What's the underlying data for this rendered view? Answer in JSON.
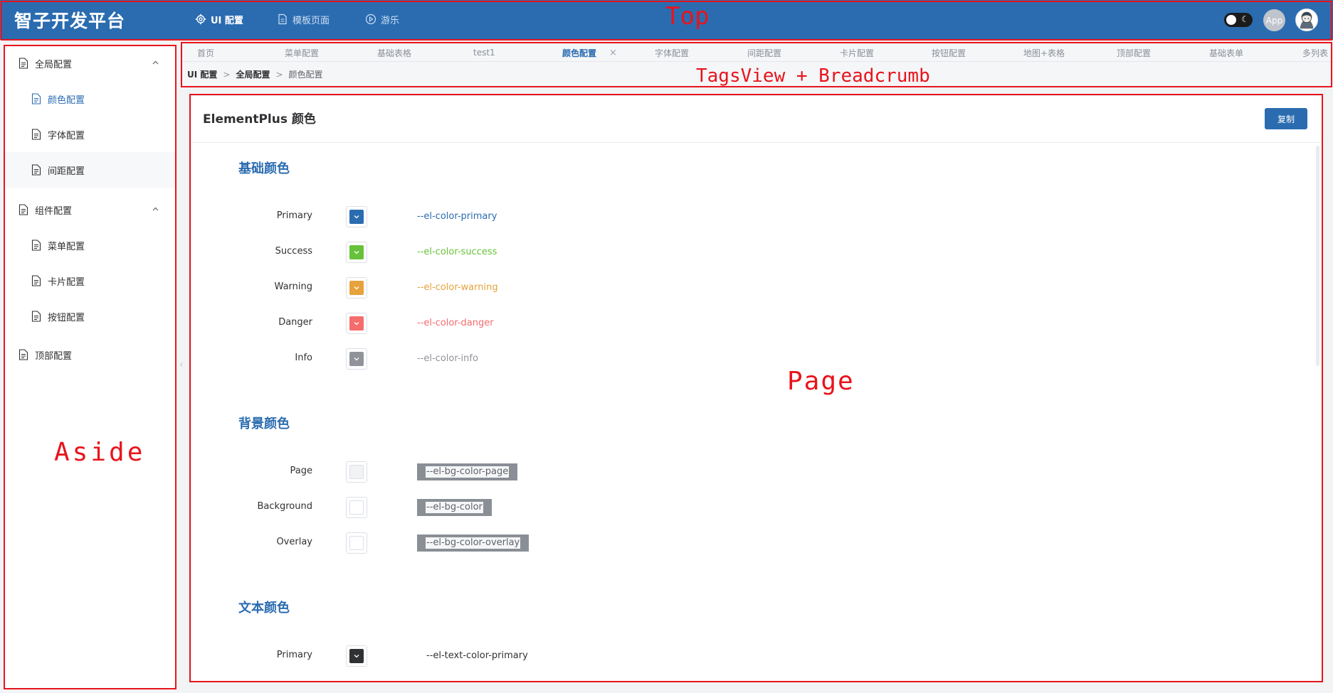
{
  "top": {
    "logo": "智子开发平台",
    "menu": [
      {
        "label": "UI 配置",
        "icon": "gear-icon",
        "active": true
      },
      {
        "label": "模板页面",
        "icon": "document-icon",
        "active": false
      },
      {
        "label": "游乐",
        "icon": "play-circle-icon",
        "active": false
      }
    ],
    "app_label": "App",
    "theme_toggle": "dark-mode-toggle"
  },
  "aside": {
    "groups": [
      {
        "label": "全局配置",
        "icon": "document-icon",
        "expanded": true,
        "items": [
          {
            "label": "颜色配置",
            "active": true
          },
          {
            "label": "字体配置",
            "active": false
          },
          {
            "label": "间距配置",
            "active": false
          }
        ]
      },
      {
        "label": "组件配置",
        "icon": "document-icon",
        "expanded": true,
        "items": [
          {
            "label": "菜单配置",
            "active": false
          },
          {
            "label": "卡片配置",
            "active": false
          },
          {
            "label": "按钮配置",
            "active": false
          }
        ]
      },
      {
        "label": "顶部配置",
        "icon": "document-icon",
        "expanded": false,
        "items": []
      }
    ]
  },
  "tags": [
    {
      "label": "首页",
      "active": false
    },
    {
      "label": "菜单配置",
      "active": false
    },
    {
      "label": "基础表格",
      "active": false
    },
    {
      "label": "test1",
      "active": false
    },
    {
      "label": "颜色配置",
      "active": true,
      "close": "×"
    },
    {
      "label": "字体配置",
      "active": false
    },
    {
      "label": "间距配置",
      "active": false
    },
    {
      "label": "卡片配置",
      "active": false
    },
    {
      "label": "按钮配置",
      "active": false
    },
    {
      "label": "地图+表格",
      "active": false
    },
    {
      "label": "顶部配置",
      "active": false
    },
    {
      "label": "基础表单",
      "active": false
    },
    {
      "label": "多列表",
      "active": false
    }
  ],
  "breadcrumb": {
    "items": [
      "UI 配置",
      "全局配置",
      "颜色配置"
    ],
    "separator": ">"
  },
  "page": {
    "title": "ElementPlus 颜色",
    "copy_label": "复制",
    "sections": [
      {
        "title": "基础颜色",
        "style": "colored-text",
        "rows": [
          {
            "label": "Primary",
            "var": "--el-color-primary",
            "color": "#2b6cb0"
          },
          {
            "label": "Success",
            "var": "--el-color-success",
            "color": "#67c23a"
          },
          {
            "label": "Warning",
            "var": "--el-color-warning",
            "color": "#e6a23c"
          },
          {
            "label": "Danger",
            "var": "--el-color-danger",
            "color": "#f56c6c"
          },
          {
            "label": "Info",
            "var": "--el-color-info",
            "color": "#909399"
          }
        ]
      },
      {
        "title": "背景颜色",
        "style": "tag",
        "rows": [
          {
            "label": "Page",
            "var": "--el-bg-color-page",
            "color": "#f2f3f5"
          },
          {
            "label": "Background",
            "var": "--el-bg-color",
            "color": "#ffffff"
          },
          {
            "label": "Overlay",
            "var": "--el-bg-color-overlay",
            "color": "#ffffff"
          }
        ]
      },
      {
        "title": "文本颜色",
        "style": "plain",
        "rows": [
          {
            "label": "Primary",
            "var": "--el-text-color-primary",
            "color": "#303133"
          }
        ]
      }
    ]
  },
  "annotations": {
    "top": "Top",
    "tags": "TagsView + Breadcrumb",
    "aside": "Aside",
    "page": "Page"
  }
}
